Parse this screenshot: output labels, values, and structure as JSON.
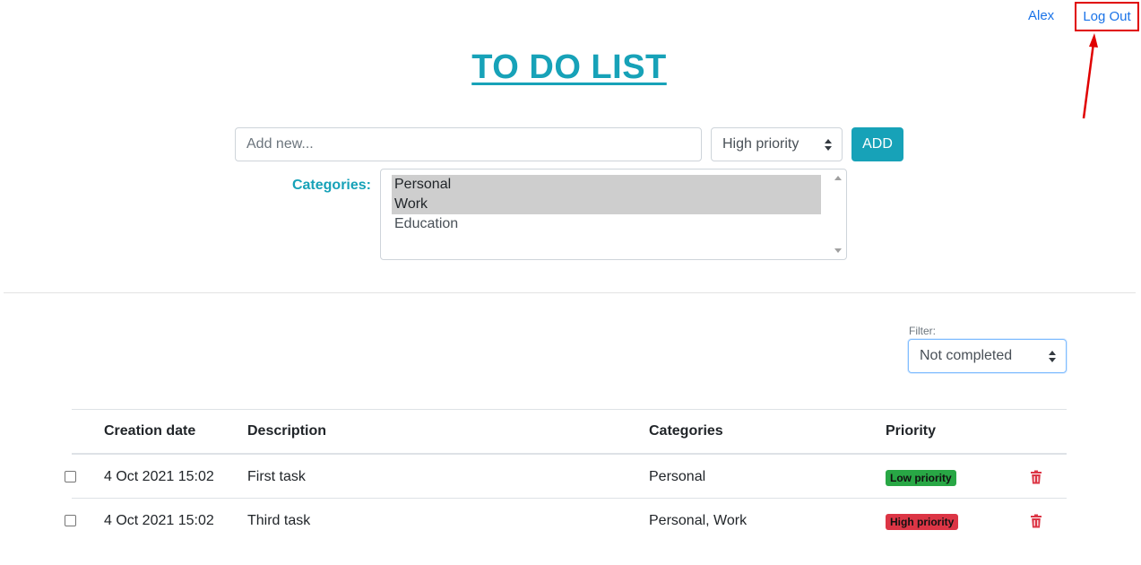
{
  "nav": {
    "user": "Alex",
    "logout": "Log Out"
  },
  "title": "TO DO LIST",
  "add_form": {
    "placeholder": "Add new...",
    "priority_value": "High priority",
    "add_label": "ADD",
    "categories_label": "Categories:",
    "categories": [
      {
        "label": "Personal",
        "selected": true
      },
      {
        "label": "Work",
        "selected": true
      },
      {
        "label": "Education",
        "selected": false
      }
    ]
  },
  "filter": {
    "label": "Filter:",
    "value": "Not completed"
  },
  "table": {
    "headers": [
      "Creation date",
      "Description",
      "Categories",
      "Priority"
    ],
    "rows": [
      {
        "date": "4 Oct 2021 15:02",
        "description": "First task",
        "categories": "Personal",
        "priority": "Low priority",
        "priority_color": "#28a745"
      },
      {
        "date": "4 Oct 2021 15:02",
        "description": "Third task",
        "categories": "Personal, Work",
        "priority": "High priority",
        "priority_color": "#dc3545"
      }
    ]
  },
  "colors": {
    "accent": "#17a2b8",
    "link": "#1a73e8",
    "annotation": "#e00000",
    "delete": "#dc3545"
  },
  "icons": {
    "delete": "trash-icon",
    "sort": "select-caret-icon"
  }
}
